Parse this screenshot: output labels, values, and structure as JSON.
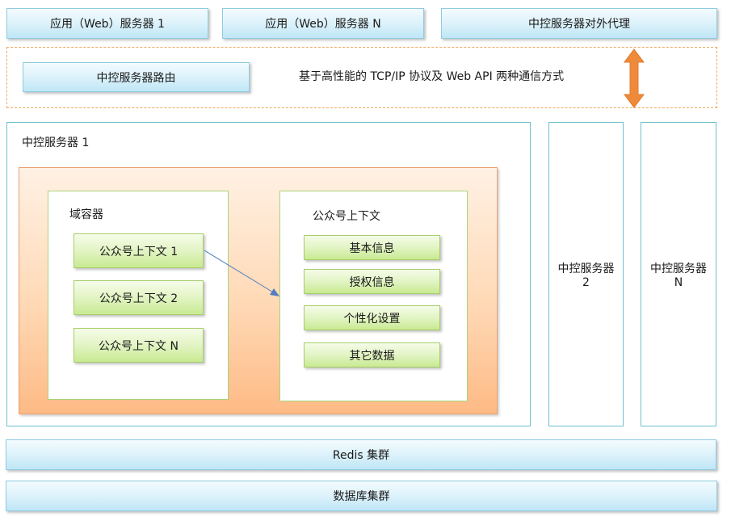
{
  "top_row": {
    "app_server_1": "应用（Web）服务器 1",
    "app_server_n": "应用（Web）服务器 N",
    "proxy": "中控服务器对外代理"
  },
  "routing": {
    "router_label": "中控服务器路由",
    "protocol_text": "基于高性能的 TCP/IP 协议及 Web API 两种通信方式"
  },
  "server1": {
    "title": "中控服务器 1",
    "domain_container": {
      "title": "域容器",
      "items": [
        "公众号上下文 1",
        "公众号上下文 2",
        "公众号上下文 N"
      ]
    },
    "context": {
      "title": "公众号上下文",
      "items": [
        "基本信息",
        "授权信息",
        "个性化设置",
        "其它数据"
      ]
    }
  },
  "side_servers": {
    "server2_line1": "中控服务器",
    "server2_line2": "2",
    "servern_line1": "中控服务器",
    "servern_line2": "N"
  },
  "bottom": {
    "redis": "Redis 集群",
    "database": "数据库集群"
  },
  "colors": {
    "box_blue": "#bfe6f6",
    "box_green": "#c9ea92",
    "orange_panel": "#fdba85",
    "arrow_orange": "#ef8a3a",
    "arrow_blue": "#4f7fbf"
  }
}
